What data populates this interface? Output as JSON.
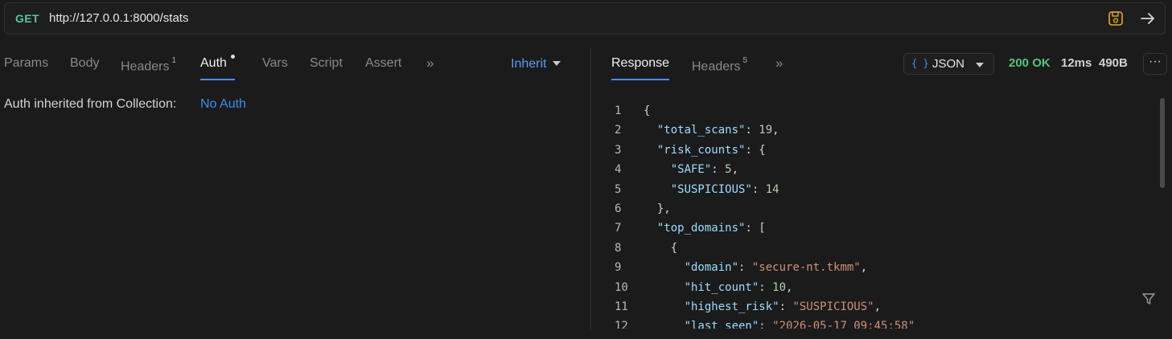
{
  "request": {
    "method": "GET",
    "url": "http://127.0.0.1:8000/stats"
  },
  "request_tabs": [
    {
      "label": "Params"
    },
    {
      "label": "Body"
    },
    {
      "label": "Headers",
      "badge": "1"
    },
    {
      "label": "Auth",
      "active": true
    },
    {
      "label": "Vars"
    },
    {
      "label": "Script"
    },
    {
      "label": "Assert"
    }
  ],
  "auth": {
    "mode_label": "Inherit",
    "inherited_text": "Auth inherited from Collection:",
    "inherited_value": "No Auth"
  },
  "response_tabs": [
    {
      "label": "Response",
      "active": true
    },
    {
      "label": "Headers",
      "badge": "5"
    }
  ],
  "response": {
    "format": "JSON",
    "status": "200 OK",
    "time": "12ms",
    "size": "490B"
  },
  "code_lines": [
    {
      "n": "1",
      "text": "{"
    },
    {
      "n": "2",
      "text": "  \"total_scans\": 19,"
    },
    {
      "n": "3",
      "text": "  \"risk_counts\": {"
    },
    {
      "n": "4",
      "text": "    \"SAFE\": 5,"
    },
    {
      "n": "5",
      "text": "    \"SUSPICIOUS\": 14"
    },
    {
      "n": "6",
      "text": "  },"
    },
    {
      "n": "7",
      "text": "  \"top_domains\": ["
    },
    {
      "n": "8",
      "text": "    {"
    },
    {
      "n": "9",
      "text": "      \"domain\": \"secure-nt.tkmm\","
    },
    {
      "n": "10",
      "text": "      \"hit_count\": 10,"
    },
    {
      "n": "11",
      "text": "      \"highest_risk\": \"SUSPICIOUS\","
    },
    {
      "n": "12",
      "text": "      \"last_seen\": \"2026-05-17 09:45:58\""
    }
  ],
  "icons": {
    "save": "save-icon",
    "send": "arrow-right-icon",
    "more_tabs": "double-chevron-right-icon",
    "more": "more-horizontal-icon",
    "filter": "filter-icon"
  },
  "colors": {
    "accent": "#4d8cf0",
    "method": "#59c49a",
    "status_ok": "#56c37f",
    "save_icon": "#e0a92e"
  }
}
